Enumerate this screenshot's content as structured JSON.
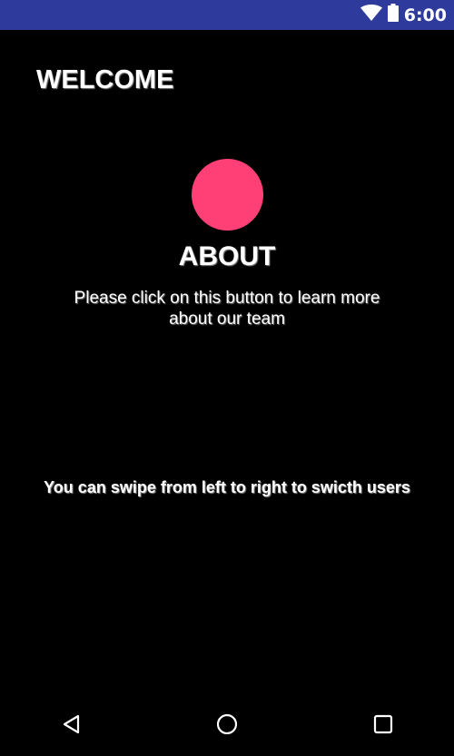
{
  "status_bar": {
    "time": "6:00",
    "icons": [
      "wifi-icon",
      "battery-icon"
    ],
    "background": "#2e3b9c"
  },
  "header": {
    "title": "WELCOME"
  },
  "about": {
    "button_color": "#ff4076",
    "title": "ABOUT",
    "description": "Please click on this button to learn more about our team"
  },
  "hint": {
    "text": "You can swipe from left to right to swicth users"
  },
  "nav_bar": {
    "buttons": [
      "back-icon",
      "home-icon",
      "recents-icon"
    ]
  }
}
